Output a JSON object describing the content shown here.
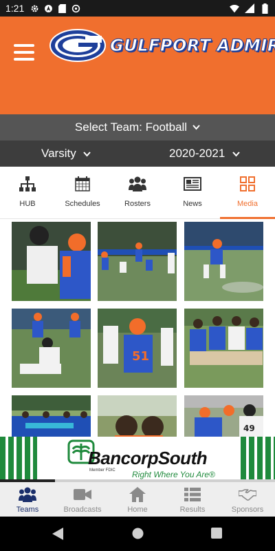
{
  "status_bar": {
    "time": "1:21"
  },
  "header": {
    "title": "GULFPORT ADMIRALS",
    "logo_letter": "G"
  },
  "team_select": {
    "label": "Select Team:",
    "value": "Football"
  },
  "filters": {
    "level": "Varsity",
    "season": "2020-2021"
  },
  "tabs": [
    {
      "label": "HUB",
      "icon": "org-chart-icon"
    },
    {
      "label": "Schedules",
      "icon": "calendar-icon"
    },
    {
      "label": "Rosters",
      "icon": "group-icon"
    },
    {
      "label": "News",
      "icon": "newspaper-icon"
    },
    {
      "label": "Media",
      "icon": "grid-icon",
      "active": true
    }
  ],
  "ad": {
    "brand": "BancorpSouth",
    "member": "Member FDIC",
    "tagline": "Right Where You Are®",
    "progress": 0.2
  },
  "bottom_nav": [
    {
      "label": "Teams",
      "icon": "people-icon",
      "active": true
    },
    {
      "label": "Broadcasts",
      "icon": "video-camera-icon"
    },
    {
      "label": "Home",
      "icon": "home-icon"
    },
    {
      "label": "Results",
      "icon": "list-icon"
    },
    {
      "label": "Sponsors",
      "icon": "handshake-icon"
    }
  ],
  "colors": {
    "brand_orange": "#f06f2e",
    "brand_blue": "#1e3f9a",
    "nav_active": "#1a2e6b",
    "sponsor_green": "#1f8a3c"
  }
}
